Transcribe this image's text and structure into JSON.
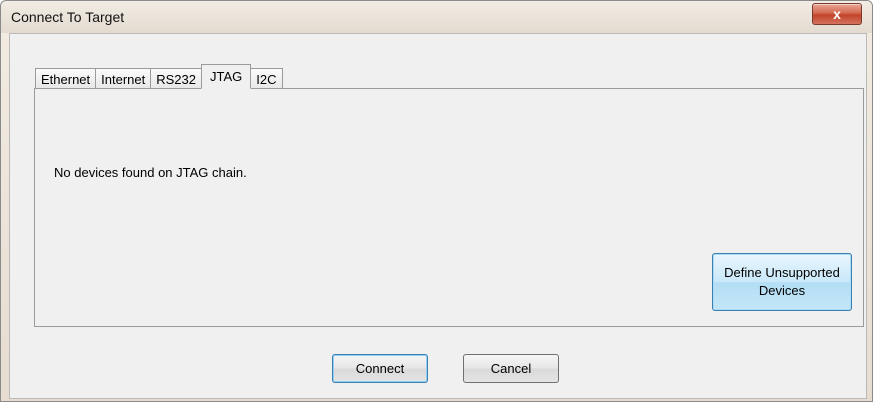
{
  "window": {
    "title": "Connect To Target",
    "close_label": "x"
  },
  "tabs": [
    {
      "label": "Ethernet",
      "active": false
    },
    {
      "label": "Internet",
      "active": false
    },
    {
      "label": "RS232",
      "active": false
    },
    {
      "label": "JTAG",
      "active": true
    },
    {
      "label": "I2C",
      "active": false
    }
  ],
  "panel": {
    "message": "No devices found on JTAG chain.",
    "define_button_label": "Define Unsupported\nDevices"
  },
  "buttons": {
    "connect_label": "Connect",
    "cancel_label": "Cancel"
  }
}
